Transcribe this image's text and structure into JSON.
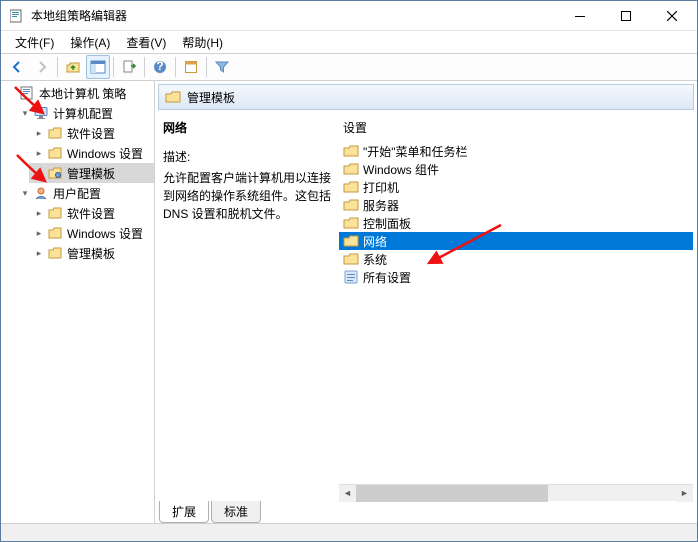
{
  "window": {
    "title": "本地组策略编辑器"
  },
  "menu": {
    "file": "文件(F)",
    "action": "操作(A)",
    "view": "查看(V)",
    "help": "帮助(H)"
  },
  "tree": {
    "root_label": "本地计算机 策略",
    "computer_cfg": "计算机配置",
    "software_settings": "软件设置",
    "windows_settings": "Windows 设置",
    "admin_templates": "管理模板",
    "user_cfg": "用户配置"
  },
  "detail": {
    "header": "管理模板",
    "category_title": "网络",
    "desc_label": "描述:",
    "desc_text": "允许配置客户端计算机用以连接到网络的操作系统组件。这包括 DNS 设置和脱机文件。",
    "settings_header": "设置",
    "items": [
      {
        "label": "\"开始\"菜单和任务栏",
        "type": "folder"
      },
      {
        "label": "Windows 组件",
        "type": "folder"
      },
      {
        "label": "打印机",
        "type": "folder"
      },
      {
        "label": "服务器",
        "type": "folder"
      },
      {
        "label": "控制面板",
        "type": "folder"
      },
      {
        "label": "网络",
        "type": "folder",
        "selected": true
      },
      {
        "label": "系统",
        "type": "folder"
      },
      {
        "label": "所有设置",
        "type": "settings"
      }
    ]
  },
  "tabs": {
    "extended": "扩展",
    "standard": "标准"
  }
}
